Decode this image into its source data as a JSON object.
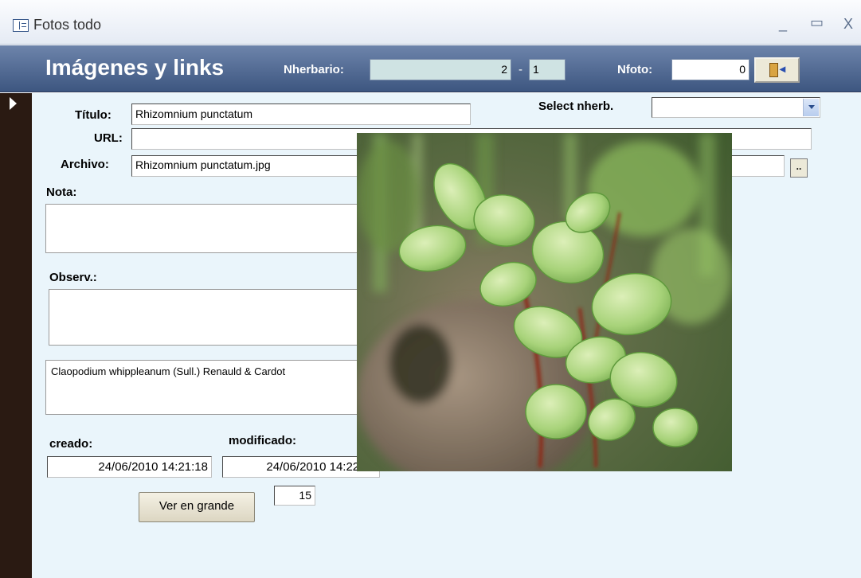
{
  "window": {
    "title": "Fotos todo",
    "controls": {
      "minimize": "_",
      "maximize": "▭",
      "close": "X"
    }
  },
  "header": {
    "form_title": "Imágenes y links",
    "nherbario_label": "Nherbario:",
    "nherbario_value": "2",
    "nherbario_separator": "-",
    "nherbario_suffix": "1",
    "nfoto_label": "Nfoto:",
    "nfoto_value": "0"
  },
  "form": {
    "titulo_label": "Título:",
    "titulo_value": "Rhizomnium punctatum",
    "select_nherb_label": "Select nherb.",
    "select_nherb_value": "",
    "url_label": "URL:",
    "url_value": "",
    "archivo_label": "Archivo:",
    "archivo_value": "Rhizomnium punctatum.jpg",
    "browse_label": "..",
    "nota_label": "Nota:",
    "nota_value": "",
    "observ_label": "Observ.:",
    "observ_value": "",
    "species_text": "Claopodium whippleanum (Sull.) Renauld & Cardot",
    "creado_label": "creado:",
    "creado_value": "24/06/2010 14:21:18",
    "modificado_label": "modificado:",
    "modificado_value": "24/06/2010 14:22:21",
    "ver_button_label": "Ver en grande",
    "count_value": "15"
  },
  "image": {
    "subject": "moss-photo",
    "colors": {
      "leaf": "#a8d37a",
      "leaf_dark": "#5f9a3c",
      "leaf_light": "#d6ecb4",
      "stem": "#8a2e1a",
      "rock": "#8c7a66",
      "background": "#4f6e3a"
    }
  },
  "colors": {
    "header_top": "#6d84ab",
    "header_bottom": "#3d5680",
    "detail_bg": "#eaf5fb",
    "record_selector": "#2a1a12",
    "nherbario_field_bg": "#cfe3e3"
  }
}
